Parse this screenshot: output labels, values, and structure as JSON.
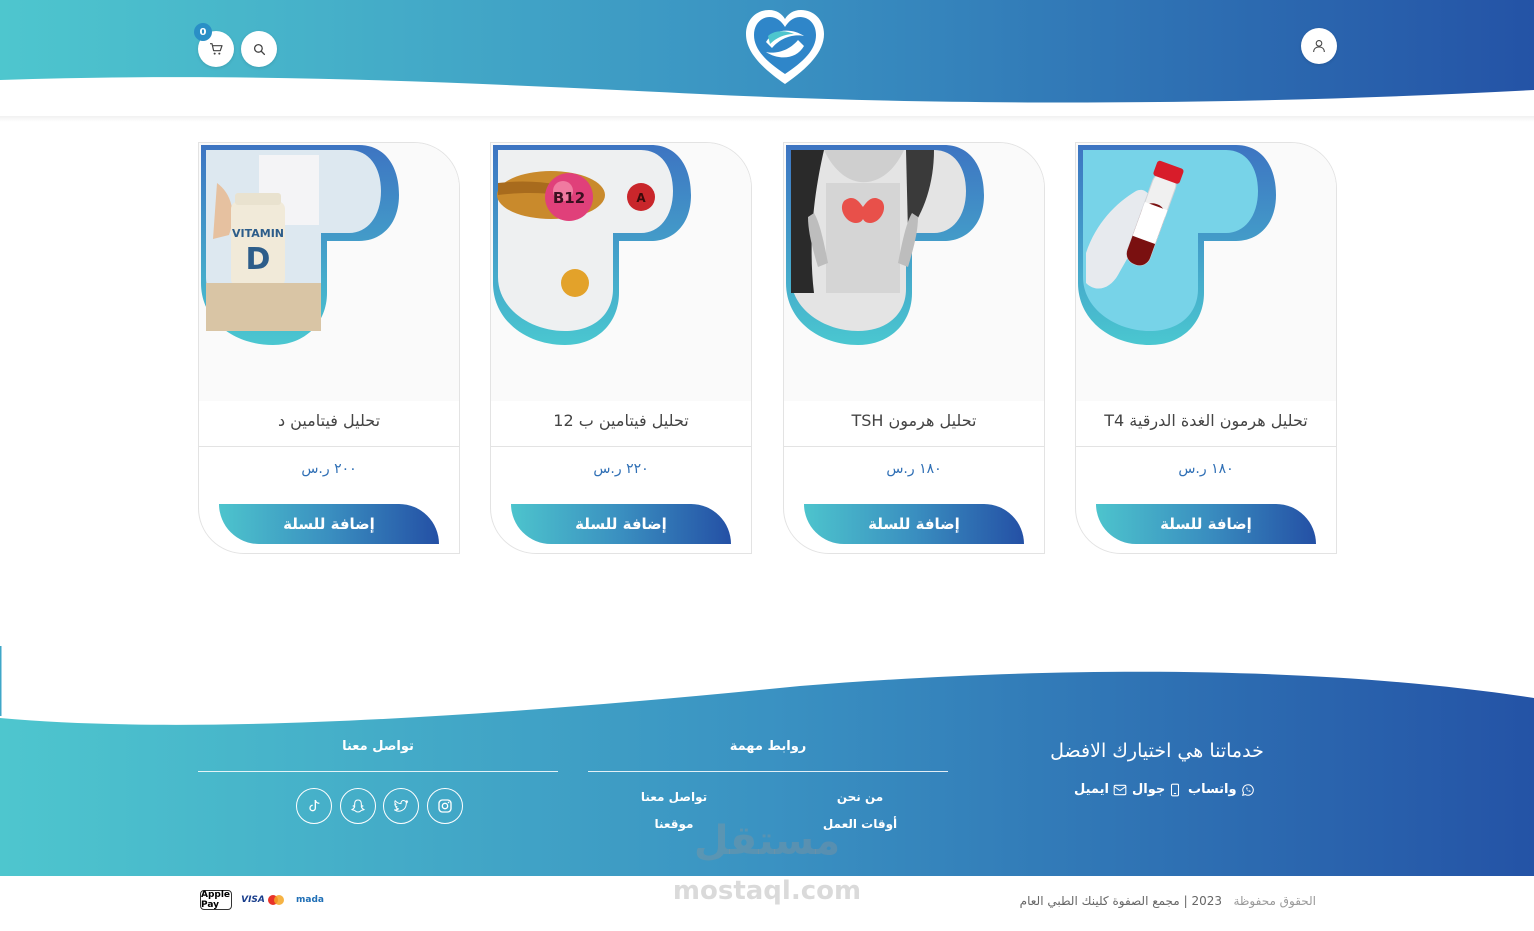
{
  "header": {
    "cart_count": "0",
    "colors": {
      "gradient_start": "#4ec6ce",
      "gradient_end": "#2453a6"
    }
  },
  "products": [
    {
      "title": "تحليل فيتامين د",
      "price": "٢٠٠ ر.س",
      "button": "إضافة للسلة",
      "image_icon": "vitamin-d-icon",
      "image_text": "VITAMIN",
      "image_letter": "D"
    },
    {
      "title": "تحليل فيتامين ب 12",
      "price": "٢٢٠ ر.س",
      "button": "إضافة للسلة",
      "image_icon": "vitamin-b12-icon",
      "image_text": "B12",
      "image_letter": "A"
    },
    {
      "title": "تحليل هرمون TSH",
      "price": "١٨٠ ر.س",
      "button": "إضافة للسلة",
      "image_icon": "thyroid-icon"
    },
    {
      "title": "تحليل هرمون الغدة الدرقية T4",
      "price": "١٨٠ ر.س",
      "button": "إضافة للسلة",
      "image_icon": "blood-tube-icon"
    }
  ],
  "footer": {
    "headline": "خدماتنا هي اختيارك الافضل",
    "contacts": {
      "whatsapp": "واتساب",
      "mobile": "جوال",
      "email": "ايميل"
    },
    "links_title": "روابط مهمة",
    "links": {
      "about": "من نحن",
      "contact_us": "تواصل معنا",
      "hours": "أوقات العمل",
      "location": "موقعنا"
    },
    "social_title": "تواصل معنا",
    "social_icons": [
      "instagram-icon",
      "twitter-icon",
      "snapchat-icon",
      "tiktok-icon"
    ]
  },
  "bottom": {
    "rights": "الحقوق محفوظة",
    "year": "2023",
    "separator": "|",
    "clinic": "مجمع الصفوة كلينك الطبي العام",
    "payments": [
      "Apple Pay",
      "VISA",
      "mada"
    ]
  },
  "watermark": {
    "arabic": "مستقل",
    "latin": "mostaql.com"
  }
}
